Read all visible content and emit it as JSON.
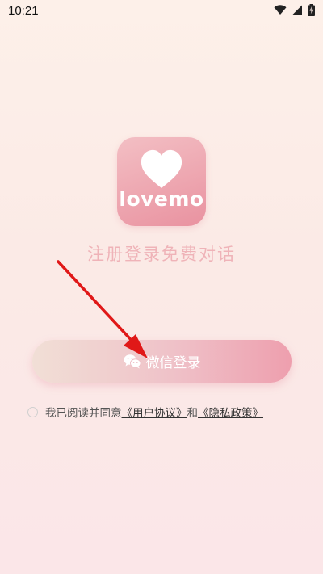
{
  "status_bar": {
    "time": "10:21"
  },
  "logo": {
    "wordmark": "lovemo"
  },
  "tagline": "注册登录免费对话",
  "wechat_button": {
    "label": "微信登录"
  },
  "agreement": {
    "prefix": "我已阅读并同意",
    "user_agreement": "《用户协议》",
    "conjunction": "和",
    "privacy_policy": "《隐私政策》"
  },
  "colors": {
    "accent_pink": "#ee9fae",
    "tagline": "#efb3b8",
    "annotation_arrow": "#e01818"
  }
}
